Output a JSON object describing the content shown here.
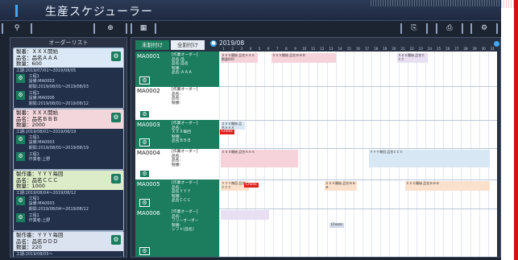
{
  "app": {
    "title": "生産スケジューラー"
  },
  "colors": {
    "accent_green": "#1b7c5e",
    "accent_blue": "#3fa9f5",
    "alert_red": "#e02020"
  },
  "toolbar": {
    "left_icons": [
      "search-icon",
      "add-icon",
      "calendar-icon"
    ],
    "right_icons": [
      "export-icon",
      "import-icon",
      "gear-icon"
    ],
    "glyphs": {
      "search": "⚲",
      "add": "⊕",
      "calendar": "▦",
      "export": "⎘",
      "import": "⎙",
      "settings": "⚙"
    }
  },
  "order_list": {
    "title": "オーダーリスト",
    "orders": [
      {
        "line1": "製番：ＸＸＸ開始",
        "line2": "品名：品名ＡＡＡ",
        "line3": "数量：600",
        "date": "工期:2019/07/01～2019/08/05",
        "procs": [
          {
            "name": "工程1",
            "machine": "設備:MA0003",
            "period": "期間:2019/08/01～2019/08/03"
          },
          {
            "name": "工程1",
            "machine": "設備:MA0006",
            "period": "期間:2019/08/01～2019/08/12"
          }
        ]
      },
      {
        "line1": "製番：ＸＸＸ開始",
        "line2": "品名：品名ＢＢＢ",
        "line3": "数量：2000",
        "date": "工期:2019/08/01～2019/08/19",
        "procs": [
          {
            "name": "工程1",
            "machine": "設備:MA0003",
            "period": "期間:2019/08/01～2019/08/19"
          },
          {
            "name": "工程1",
            "machine": "作業者:上野",
            "period": ""
          }
        ]
      },
      {
        "line1": "製作番：ＹＹＹ毎回",
        "line2": "品名：品名ＣＣＣ",
        "line3": "数量：1000",
        "date": "工期:2019/08/04～2019/08/12",
        "procs": [
          {
            "name": "工程1",
            "machine": "設備:MA0003",
            "period": "期間:2019/08/04～2019/08/12"
          },
          {
            "name": "工程1",
            "machine": "作業者:上野",
            "period": ""
          }
        ]
      },
      {
        "line1": "製作番：ＹＹＹ毎回",
        "line2": "品名：品名ＤＤＤ",
        "line3": "数量：220",
        "date": "工期:2019/08/05～",
        "procs": []
      }
    ]
  },
  "gantt": {
    "tabs": [
      "未割付け",
      "全割付け"
    ],
    "month": "2019/08",
    "days": [
      "1",
      "2",
      "3",
      "4",
      "5",
      "6",
      "7",
      "8",
      "9",
      "10",
      "11",
      "12",
      "13",
      "14",
      "15",
      "16",
      "17",
      "18",
      "19",
      "20",
      "21",
      "22",
      "23",
      "24",
      "25",
      "26",
      "27",
      "28",
      "29",
      "30",
      "31"
    ],
    "machines": [
      {
        "code": "MA0001",
        "info": [
          "[作業オーダー]",
          "品名:品",
          "品名:品名",
          "製番:",
          "品名:ＡＡＡ"
        ],
        "highlight": true
      },
      {
        "code": "MA0002",
        "info": [
          "[作業オーダー]",
          "品名:",
          "品名:",
          "製番:"
        ],
        "highlight": false
      },
      {
        "code": "MA0003",
        "info": [
          "[作業オーダー]",
          "品名:",
          "ＸＸＸ毎回",
          "製番:",
          "品名ＢＢＢ"
        ],
        "highlight": true
      },
      {
        "code": "MA0004",
        "info": [
          "[作業オーダー]",
          "品名:",
          "品名:",
          "製番:"
        ],
        "highlight": false
      },
      {
        "code": "MA0005",
        "info": [
          "[作業オーダー]",
          "品名:",
          "品名ＹＹＹ",
          "製番:",
          "品名ＣＣＣ"
        ],
        "highlight": true
      },
      {
        "code": "MA0006",
        "info": [
          "[作業オーダー]",
          "品名:",
          "フリーオーダー",
          "製番:",
          "シフト(品名)"
        ],
        "highlight": true
      }
    ],
    "bars": [
      {
        "text": "ＸＸＸ開始 品名ＡＡＡ 数量600"
      },
      {
        "text": "ＸＸＸ開始 品名ＢＢＢ"
      },
      {
        "text": "ＸＸＸ開始 品名ＣＣＣ"
      },
      {
        "text": "ＸＸＸ開始 品名ＡＡＡ"
      },
      {
        "text": "ＸＸＸ開始 品名ＡＡＡ"
      },
      {
        "text": "ＹＹＹ毎回 品名ＣＣＣ"
      },
      {
        "text": "ＹＹＹ毎回 品名ＣＣＣ"
      },
      {
        "text": "ＸＸＸ開始 品名ＢＢＢ"
      },
      {
        "text": "ＸＸＸ開始 品名ＢＢＢ"
      }
    ],
    "tags": [
      "Check",
      "Check",
      "Check",
      "Check"
    ]
  }
}
